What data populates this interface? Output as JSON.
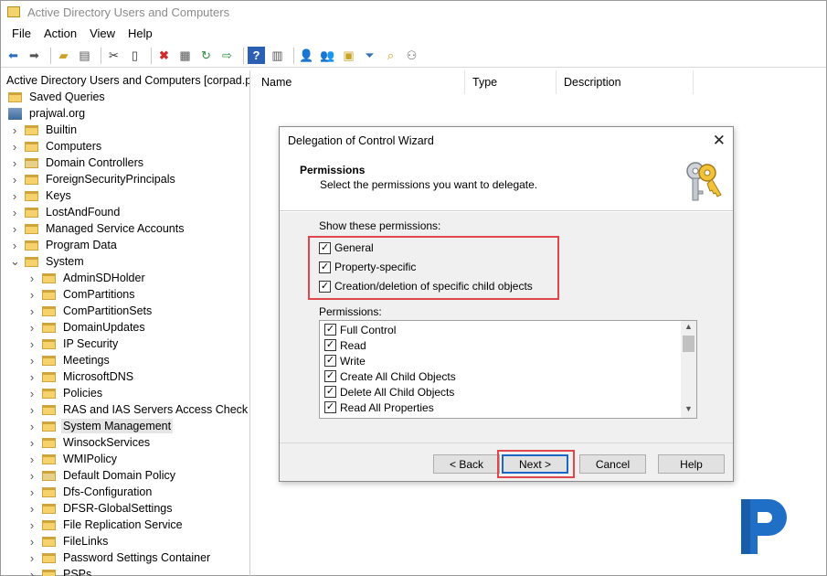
{
  "window": {
    "title": "Active Directory Users and Computers"
  },
  "menu": [
    "File",
    "Action",
    "View",
    "Help"
  ],
  "toolbar": {
    "icons": [
      "back-icon",
      "forward-icon",
      "up-folder-icon",
      "show-tree-icon",
      "cut-icon",
      "copy-icon",
      "delete-icon",
      "properties-icon",
      "refresh-icon",
      "export-list-icon",
      "help-icon",
      "action-pane-icon",
      "user-icon",
      "group-icon",
      "ou-icon",
      "filter-icon",
      "find-icon",
      "users-icon"
    ]
  },
  "tree": {
    "root": "Active Directory Users and Computers [corpad.pra",
    "saved_queries": "Saved Queries",
    "domain": "prajwal.org",
    "level1": [
      "Builtin",
      "Computers",
      "Domain Controllers",
      "ForeignSecurityPrincipals",
      "Keys",
      "LostAndFound",
      "Managed Service Accounts",
      "Program Data",
      "System"
    ],
    "system_children": [
      "AdminSDHolder",
      "ComPartitions",
      "ComPartitionSets",
      "DomainUpdates",
      "IP Security",
      "Meetings",
      "MicrosoftDNS",
      "Policies",
      "RAS and IAS Servers Access Check",
      "System Management",
      "WinsockServices",
      "WMIPolicy",
      "Default Domain Policy",
      "Dfs-Configuration",
      "DFSR-GlobalSettings",
      "File Replication Service",
      "FileLinks",
      "Password Settings Container",
      "PSPs"
    ],
    "selected": "System Management"
  },
  "list": {
    "columns": [
      "Name",
      "Type",
      "Description"
    ]
  },
  "dialog": {
    "title": "Delegation of Control Wizard",
    "close": "✕",
    "heading": "Permissions",
    "subheading": "Select the permissions you want to delegate.",
    "show_label": "Show these permissions:",
    "show_options": [
      {
        "label": "General",
        "checked": true
      },
      {
        "label": "Property-specific",
        "checked": true
      },
      {
        "label": "Creation/deletion of specific child objects",
        "checked": true
      }
    ],
    "permissions_label": "Permissions:",
    "permissions": [
      {
        "label": "Full Control",
        "checked": true
      },
      {
        "label": "Read",
        "checked": true
      },
      {
        "label": "Write",
        "checked": true
      },
      {
        "label": "Create All Child Objects",
        "checked": true
      },
      {
        "label": "Delete All Child Objects",
        "checked": true
      },
      {
        "label": "Read All Properties",
        "checked": true
      }
    ],
    "buttons": {
      "back": "< Back",
      "next": "Next >",
      "cancel": "Cancel",
      "help": "Help"
    }
  },
  "colors": {
    "highlight": "#e0474c",
    "folder": "#f5d26b",
    "logo": "#1f6fc6"
  }
}
